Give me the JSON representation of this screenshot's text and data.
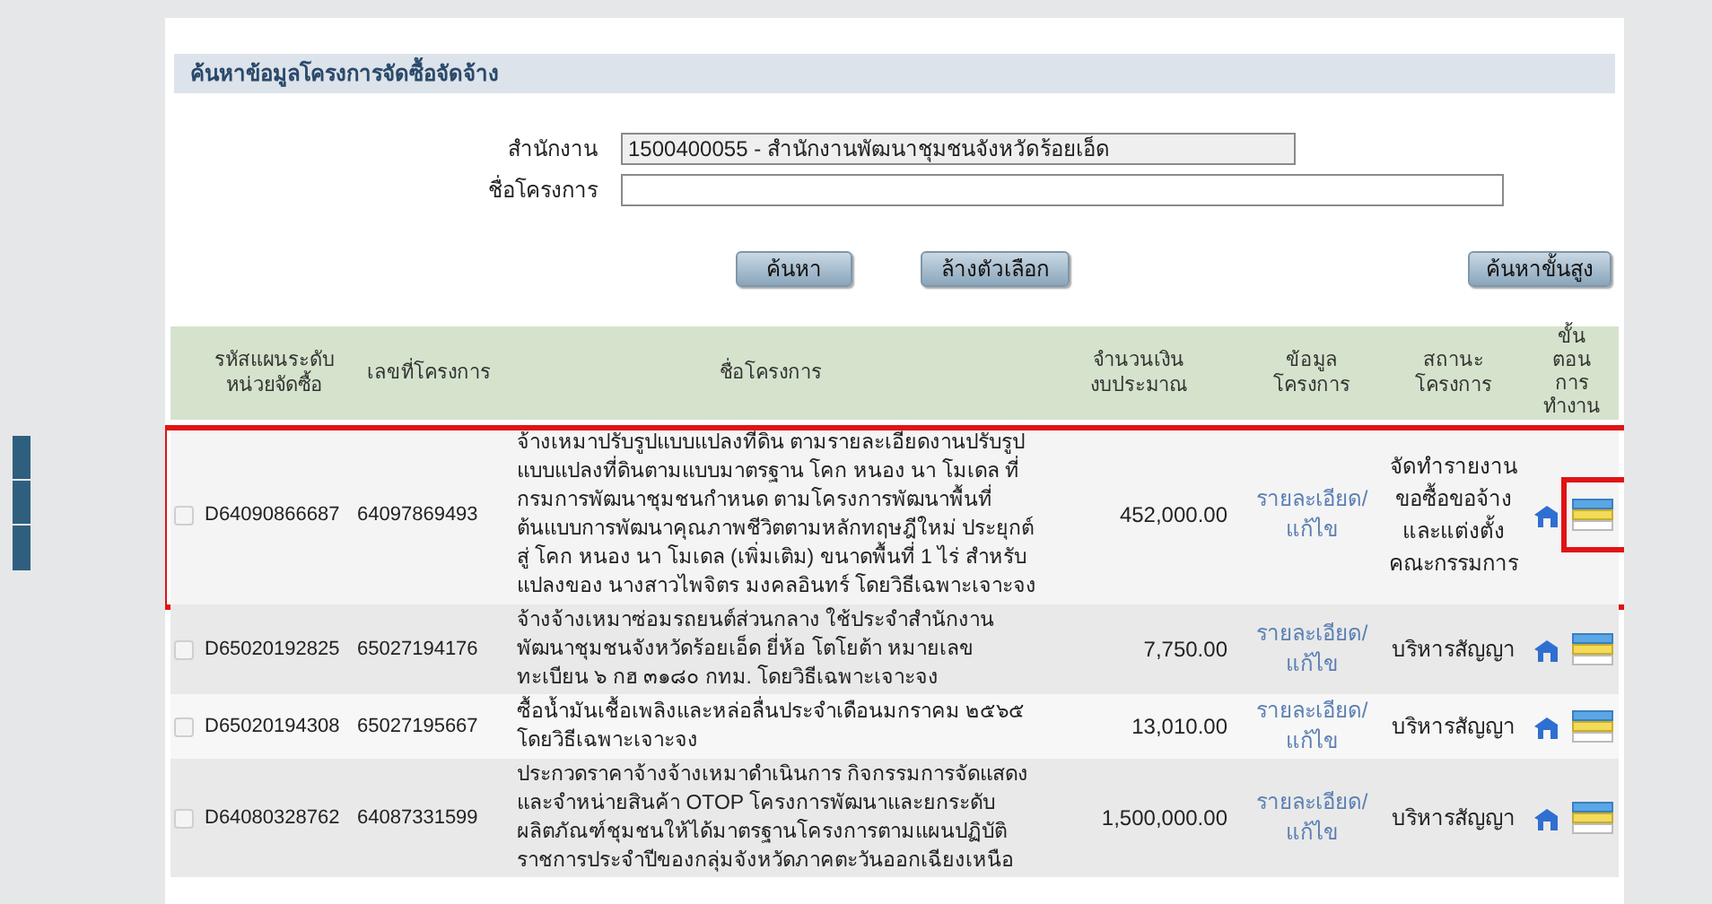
{
  "section": {
    "title": "ค้นหาข้อมูลโครงการจัดซื้อจัดจ้าง"
  },
  "form": {
    "fields": [
      {
        "label": "สำนักงาน",
        "value": "1500400055 - สำนักงานพัฒนาชุมชนจังหวัดร้อยเอ็ด",
        "disabled": true
      },
      {
        "label": "ชื่อโครงการ",
        "disabled": false
      }
    ]
  },
  "buttons": [
    {
      "label": "ค้นหา"
    },
    {
      "label": "ล้างตัวเลือก"
    },
    {
      "label": "ค้นหาขั้นสูง"
    }
  ],
  "table": {
    "columns": [
      "รหัสแผนระดับ\nหน่วยจัดซื้อ",
      "เลขที่โครงการ",
      "ชื่อโครงการ",
      "จำนวนเงิน\nงบประมาณ",
      "ข้อมูล\nโครงการ",
      "สถานะ\nโครงการ",
      "ขั้น\nตอน\nการ\nทำงาน"
    ],
    "rows": [
      {
        "checked": false,
        "plan_code": "D64090866687",
        "project_no": "64097869493",
        "name": "จ้างเหมาปรับรูปแบบแปลงที่ดิน ตามรายละเอียดงานปรับรูป\nแบบแปลงที่ดินตามแบบมาตรฐาน โคก หนอง นา โมเดล ที่\nกรมการพัฒนาชุมชนกำหนด ตามโครงการพัฒนาพื้นที่\nต้นแบบการพัฒนาคุณภาพชีวิตตามหลักทฤษฎีใหม่ ประยุกต์\nสู่ โคก หนอง นา โมเดล (เพิ่มเติม) ขนาดพื้นที่ 1 ไร่ สำหรับ\nแปลงของ นางสาวไพจิตร มงคลอินทร์ โดยวิธีเฉพาะเจาะจง",
        "amount": "452,000.00",
        "link": "รายละเอียด/\nแก้ไข",
        "status": "จัดทำรายงาน\nขอซื้อขอจ้าง\nและแต่งตั้ง\nคณะกรรมการ",
        "highlighted": true,
        "icon_highlighted": true
      },
      {
        "checked": false,
        "plan_code": "D65020192825",
        "project_no": "65027194176",
        "name": "จ้างจ้างเหมาซ่อมรถยนต์ส่วนกลาง ใช้ประจำสำนักงาน\nพัฒนาชุมชนจังหวัดร้อยเอ็ด ยี่ห้อ โตโยต้า หมายเลข\nทะเบียน ๖ กฮ ๓๑๘๐ กทม. โดยวิธีเฉพาะเจาะจง",
        "amount": "7,750.00",
        "link": "รายละเอียด/\nแก้ไข",
        "status": "บริหารสัญญา",
        "highlighted": false,
        "icon_highlighted": false
      },
      {
        "checked": false,
        "plan_code": "D65020194308",
        "project_no": "65027195667",
        "name": "ซื้อน้ำมันเชื้อเพลิงและหล่อลื่นประจำเดือนมกราคม ๒๕๖๕\nโดยวิธีเฉพาะเจาะจง",
        "amount": "13,010.00",
        "link": "รายละเอียด/\nแก้ไข",
        "status": "บริหารสัญญา",
        "highlighted": false,
        "icon_highlighted": false
      },
      {
        "checked": false,
        "plan_code": "D64080328762",
        "project_no": "64087331599",
        "name": "ประกวดราคาจ้างจ้างเหมาดำเนินการ กิจกรรมการจัดแสดง\nและจำหน่ายสินค้า OTOP โครงการพัฒนาและยกระดับ\nผลิตภัณฑ์ชุมชนให้ได้มาตรฐานโครงการตามแผนปฏิบัติ\nราชการประจำปีของกลุ่มจังหวัดภาคตะวันออกเฉียงเหนือ",
        "amount": "1,500,000.00",
        "link": "รายละเอียด/\nแก้ไข",
        "status": "บริหารสัญญา",
        "highlighted": false,
        "icon_highlighted": false
      }
    ]
  }
}
